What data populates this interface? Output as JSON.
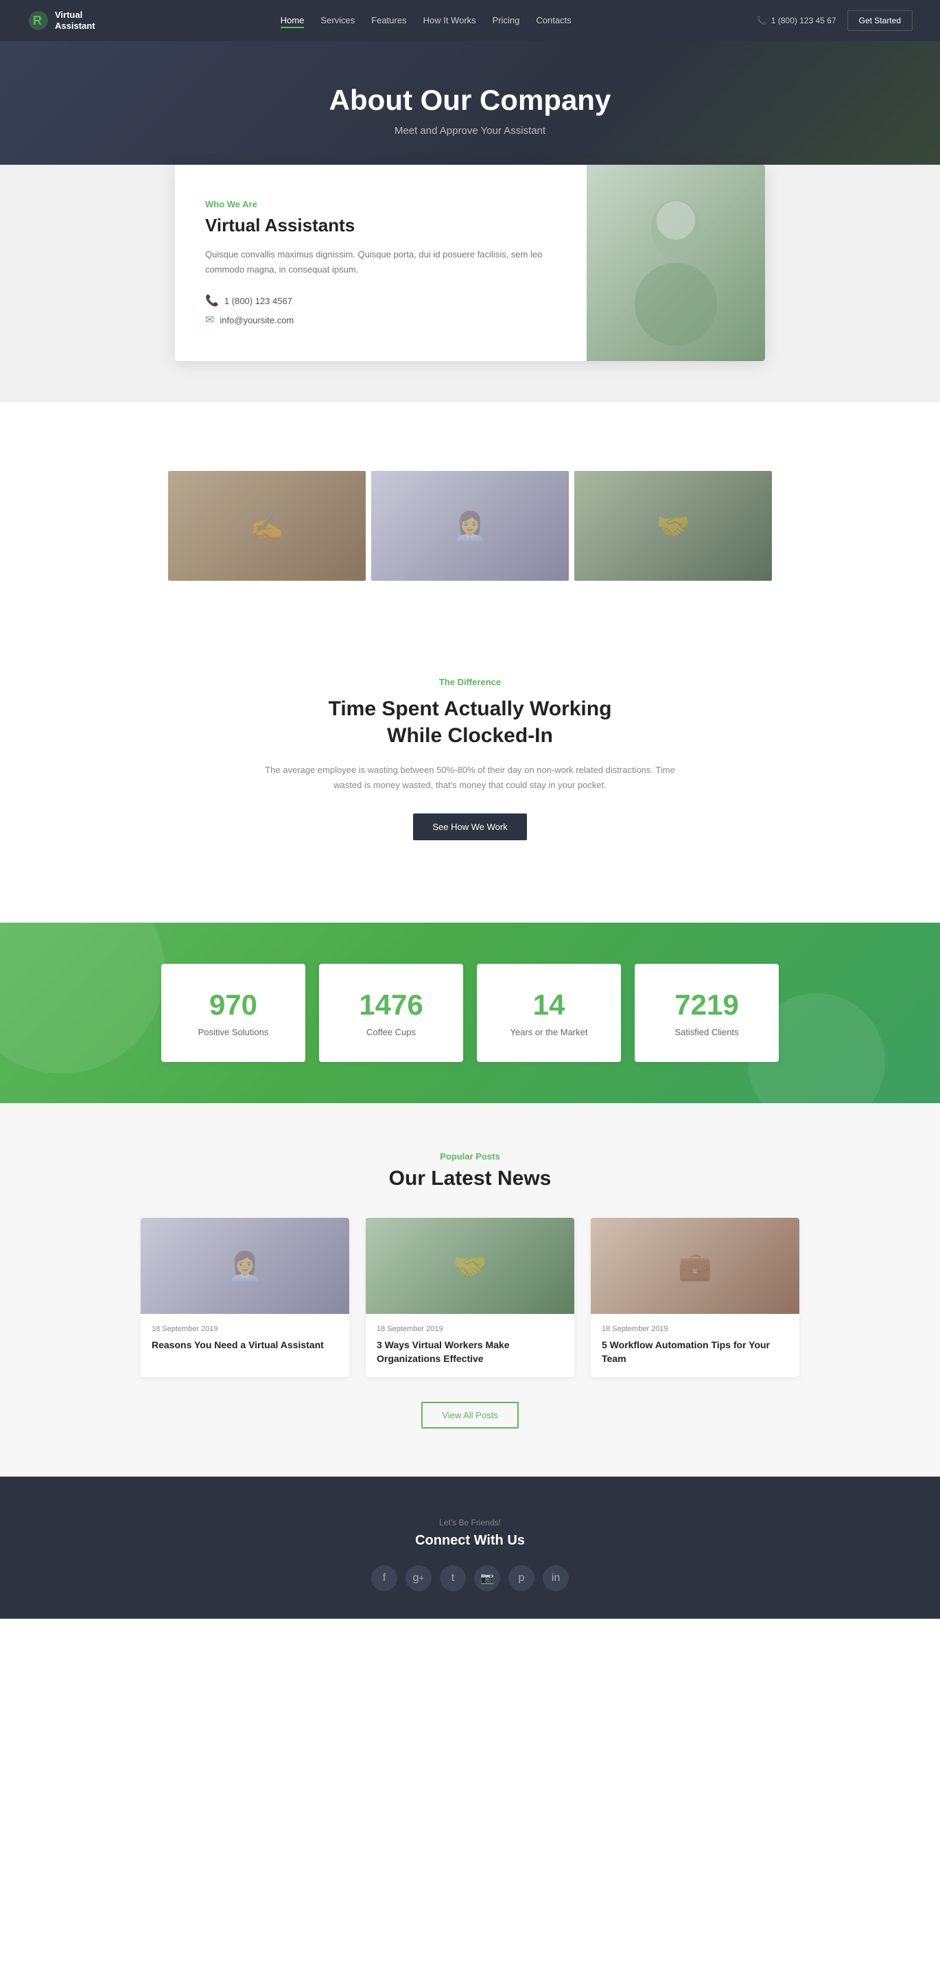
{
  "brand": {
    "name_line1": "Virtual",
    "name_line2": "Assistant",
    "logo_symbol": "R"
  },
  "nav": {
    "links": [
      {
        "label": "Home",
        "active": true
      },
      {
        "label": "Services",
        "active": false
      },
      {
        "label": "Features",
        "active": false
      },
      {
        "label": "How It Works",
        "active": false
      },
      {
        "label": "Pricing",
        "active": false
      },
      {
        "label": "Contacts",
        "active": false
      }
    ],
    "phone": "1 (800) 123 45 67",
    "cta_label": "Get Started"
  },
  "hero": {
    "title": "About Our Company",
    "subtitle": "Meet and Approve Your Assistant"
  },
  "about": {
    "who_label": "Who We Are",
    "title": "Virtual Assistants",
    "description": "Quisque convallis maximus dignissim. Quisque porta, dui id posuere facilisis, sem leo commodo magna, in consequat ipsum.",
    "phone": "1 (800) 123 4567",
    "email": "info@yoursite.com"
  },
  "difference": {
    "label": "The Difference",
    "title": "Time Spent Actually Working\nWhile Clocked-In",
    "description": "The average employee is wasting between 50%-80% of their day on non-work related distractions. Time wasted is money wasted, that's money that could stay in your pocket.",
    "cta_label": "See How We Work"
  },
  "stats": [
    {
      "number": "970",
      "label": "Positive Solutions"
    },
    {
      "number": "1476",
      "label": "Coffee Cups"
    },
    {
      "number": "14",
      "label": "Years or the Market"
    },
    {
      "number": "7219",
      "label": "Satisfied Clients"
    }
  ],
  "news": {
    "section_label": "Popular Posts",
    "section_title": "Our Latest News",
    "posts": [
      {
        "date": "18 September 2019",
        "title": "Reasons You Need a Virtual Assistant"
      },
      {
        "date": "18 September 2019",
        "title": "3 Ways Virtual Workers Make Organizations Effective"
      },
      {
        "date": "18 September 2019",
        "title": "5 Workflow Automation Tips for Your Team"
      }
    ],
    "view_all_label": "View All Posts"
  },
  "footer": {
    "tagline": "Let's Be Friends!",
    "connect_title": "Connect With Us",
    "social": [
      {
        "name": "facebook",
        "symbol": "f"
      },
      {
        "name": "google-plus",
        "symbol": "g+"
      },
      {
        "name": "twitter",
        "symbol": "t"
      },
      {
        "name": "instagram",
        "symbol": "📷"
      },
      {
        "name": "pinterest",
        "symbol": "p"
      },
      {
        "name": "linkedin",
        "symbol": "in"
      }
    ]
  }
}
